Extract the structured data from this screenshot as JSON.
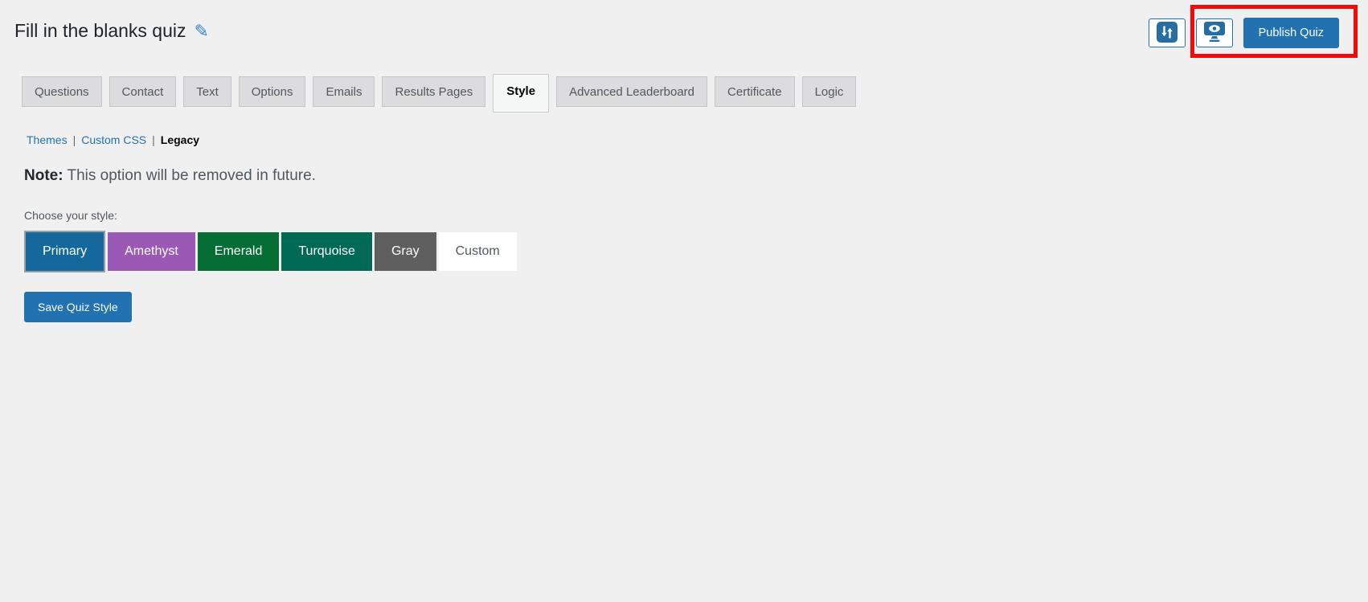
{
  "header": {
    "title": "Fill in the blanks quiz",
    "publish_label": "Publish Quiz",
    "icons": {
      "edit": "pencil-icon",
      "import_export": "import-export-icon",
      "preview": "screen-preview-icon"
    }
  },
  "tabs": [
    {
      "label": "Questions",
      "active": false
    },
    {
      "label": "Contact",
      "active": false
    },
    {
      "label": "Text",
      "active": false
    },
    {
      "label": "Options",
      "active": false
    },
    {
      "label": "Emails",
      "active": false
    },
    {
      "label": "Results Pages",
      "active": false
    },
    {
      "label": "Style",
      "active": true
    },
    {
      "label": "Advanced Leaderboard",
      "active": false
    },
    {
      "label": "Certificate",
      "active": false
    },
    {
      "label": "Logic",
      "active": false
    }
  ],
  "subnav": {
    "separator": "|",
    "items": [
      {
        "label": "Themes",
        "current": false
      },
      {
        "label": "Custom CSS",
        "current": false
      },
      {
        "label": "Legacy",
        "current": true
      }
    ]
  },
  "note": {
    "prefix": "Note:",
    "text": "This option will be removed in future."
  },
  "style_section": {
    "label": "Choose your style:",
    "options": [
      {
        "name": "Primary",
        "color": "#15689c",
        "text_color": "#ffffff",
        "selected": true
      },
      {
        "name": "Amethyst",
        "color": "#9b59b6",
        "text_color": "#ffffff",
        "selected": false
      },
      {
        "name": "Emerald",
        "color": "#046e35",
        "text_color": "#ffffff",
        "selected": false
      },
      {
        "name": "Turquoise",
        "color": "#006a55",
        "text_color": "#ffffff",
        "selected": false
      },
      {
        "name": "Gray",
        "color": "#5f5f5f",
        "text_color": "#ffffff",
        "selected": false
      },
      {
        "name": "Custom",
        "color": "#ffffff",
        "text_color": "#50575e",
        "selected": false
      }
    ],
    "save_label": "Save Quiz Style"
  },
  "colors": {
    "page_bg": "#f0f0f1",
    "accent": "#2271b1",
    "link": "#2271b1",
    "annotation_red": "#f30b0b",
    "icon_blue": "#266da1"
  }
}
